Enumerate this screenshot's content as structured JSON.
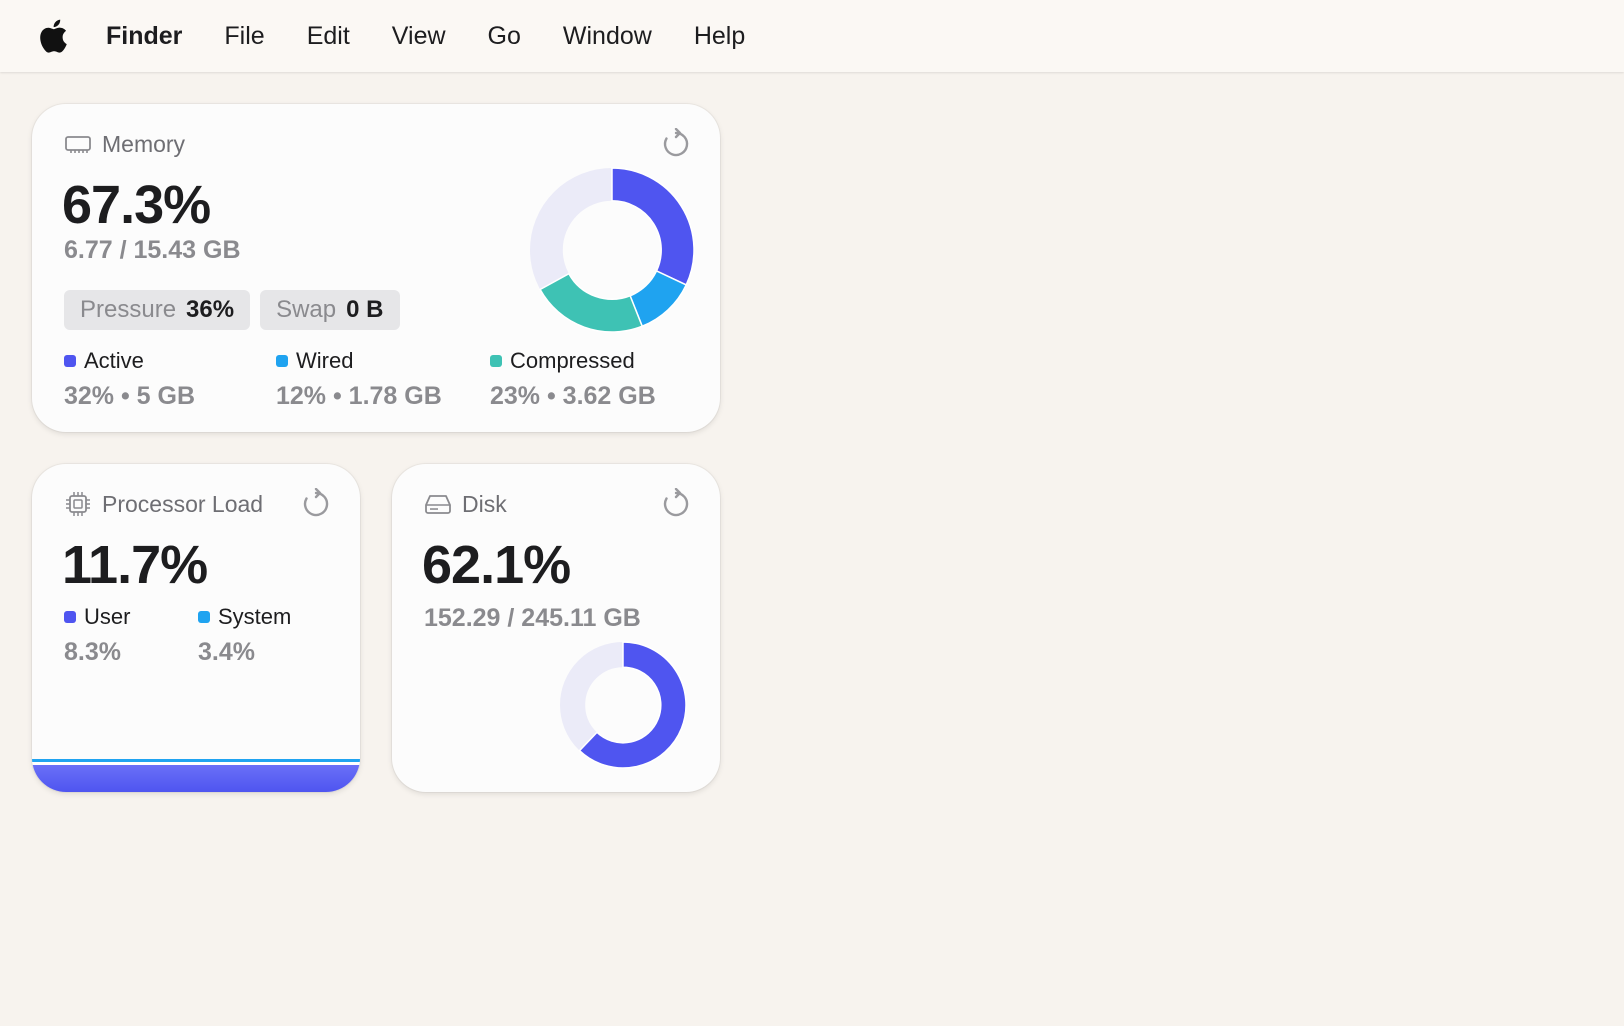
{
  "menubar": {
    "apple_icon": "apple-logo-icon",
    "items": [
      "Finder",
      "File",
      "Edit",
      "View",
      "Go",
      "Window",
      "Help"
    ]
  },
  "colors": {
    "active": "#4f55f0",
    "wired": "#1fa3f0",
    "compressed": "#3ec2b4",
    "track": "#ebebf8"
  },
  "memory": {
    "title": "Memory",
    "icon": "memory-chip-icon",
    "percent": "67.3%",
    "usage": "6.77 / 15.43 GB",
    "pressure_label": "Pressure",
    "pressure_value": "36%",
    "swap_label": "Swap",
    "swap_value": "0 B",
    "legend": [
      {
        "label": "Active",
        "value": "32% • 5 GB",
        "fraction": 0.32
      },
      {
        "label": "Wired",
        "value": "12% • 1.78 GB",
        "fraction": 0.12
      },
      {
        "label": "Compressed",
        "value": "23% • 3.62 GB",
        "fraction": 0.23
      }
    ]
  },
  "cpu": {
    "title": "Processor Load",
    "icon": "cpu-icon",
    "percent": "11.7%",
    "legend": [
      {
        "label": "User",
        "value": "8.3%",
        "fraction": 0.083
      },
      {
        "label": "System",
        "value": "3.4%",
        "fraction": 0.034
      }
    ]
  },
  "disk": {
    "title": "Disk",
    "icon": "disk-drive-icon",
    "percent": "62.1%",
    "usage": "152.29 / 245.11 GB",
    "fraction": 0.621
  }
}
